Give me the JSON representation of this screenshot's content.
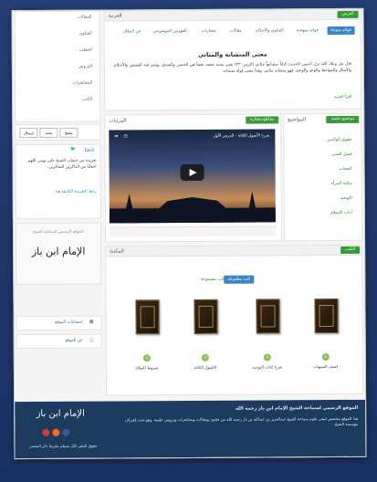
{
  "header": {
    "title_tag": "العربية"
  },
  "nav": {
    "tabs": [
      "فوائد منوعة",
      "فوائد منهجية",
      "الفتاوى والأحكام",
      "مقالات",
      "مختارات",
      "الفهرس الموضوعي",
      "عن المقال"
    ]
  },
  "top_panel": {
    "badge": "الدرس",
    "title": "معنى المتشابه والمثاني",
    "body": "قال جل وعلا: الله نزل أحسن الحديث كتاباً متشابهاً مثاني (الزمر: ٢٣) يعني يشبه بعضه بعضاً في الحسن والصدق، ويثنى فيه القصص والأحكام والأمثال والمواعظ والوعد والوعيد، فهو متشابه مثاني، وهذا معنى قوله سبحانه.",
    "read_more": "اقرأ المزيد"
  },
  "videos_panel": {
    "button": "مقاطع مختارة",
    "label": "المرئيات",
    "video_title": "شرح الأصول الثلاثة - الدرس الأول"
  },
  "topics_panel": {
    "button": "مواضيع علمية",
    "label": "المواضيع",
    "items": [
      "حقوق الوالدين",
      "فضل الصبر",
      "الحجاب",
      "مكانة المرأة",
      "التوحيد",
      "آداب الإسلام"
    ]
  },
  "books_panel": {
    "badge": "الكتب",
    "label": "المكتبة",
    "tabs": [
      "كتب مطبوعة",
      "كتب مسموعة"
    ],
    "books": [
      {
        "title": "كشف الشبهات",
        "num": "1"
      },
      {
        "title": "شرح كتاب التوحيد",
        "num": "2"
      },
      {
        "title": "الأصول الثلاثة",
        "num": "3"
      },
      {
        "title": "شروط الصلاة",
        "num": "4"
      }
    ]
  },
  "sidebar": {
    "top_items": [
      "المقالات",
      "الفتاوى",
      "الخطب",
      "الدروس",
      "المحاضرات",
      "الكتب"
    ],
    "buttons": [
      "إرسال",
      "بحث",
      "مسح"
    ],
    "social_label": "تابعنا",
    "tweet": "تغريدة من حساب الشيخ على تويتر، اللهم اجعلنا من الذاكرين الشاكرين.",
    "tweet2": "رابط التغريدة الكاملة هنا",
    "logo_text": "الإمام ابن باز",
    "logo_caption": "الموقع الرسمي لسماحة الشيخ",
    "visitors_label": "إحصائيات الموقع",
    "share_label": "عن الموقع"
  },
  "footer": {
    "title": "الموقع الرسمي لسماحة الشيخ الإمام ابن باز رحمه الله",
    "body": "هذا الموقع مخصص لنشر علوم سماحة الشيخ عبدالعزيز بن عبدالله بن باز رحمه الله من فتاوى ومقالات ومحاضرات ودروس علمية، وهو تحت إشراف مؤسسة الشيخ.",
    "logo": "الإمام ابن باز",
    "copy": "حقوق النشر لكل مسلم بشرط ذكر المصدر"
  },
  "colors": {
    "accent": "#3a9a3a",
    "tab_active": "#3a84c8",
    "footer": "#1d3b5e"
  }
}
